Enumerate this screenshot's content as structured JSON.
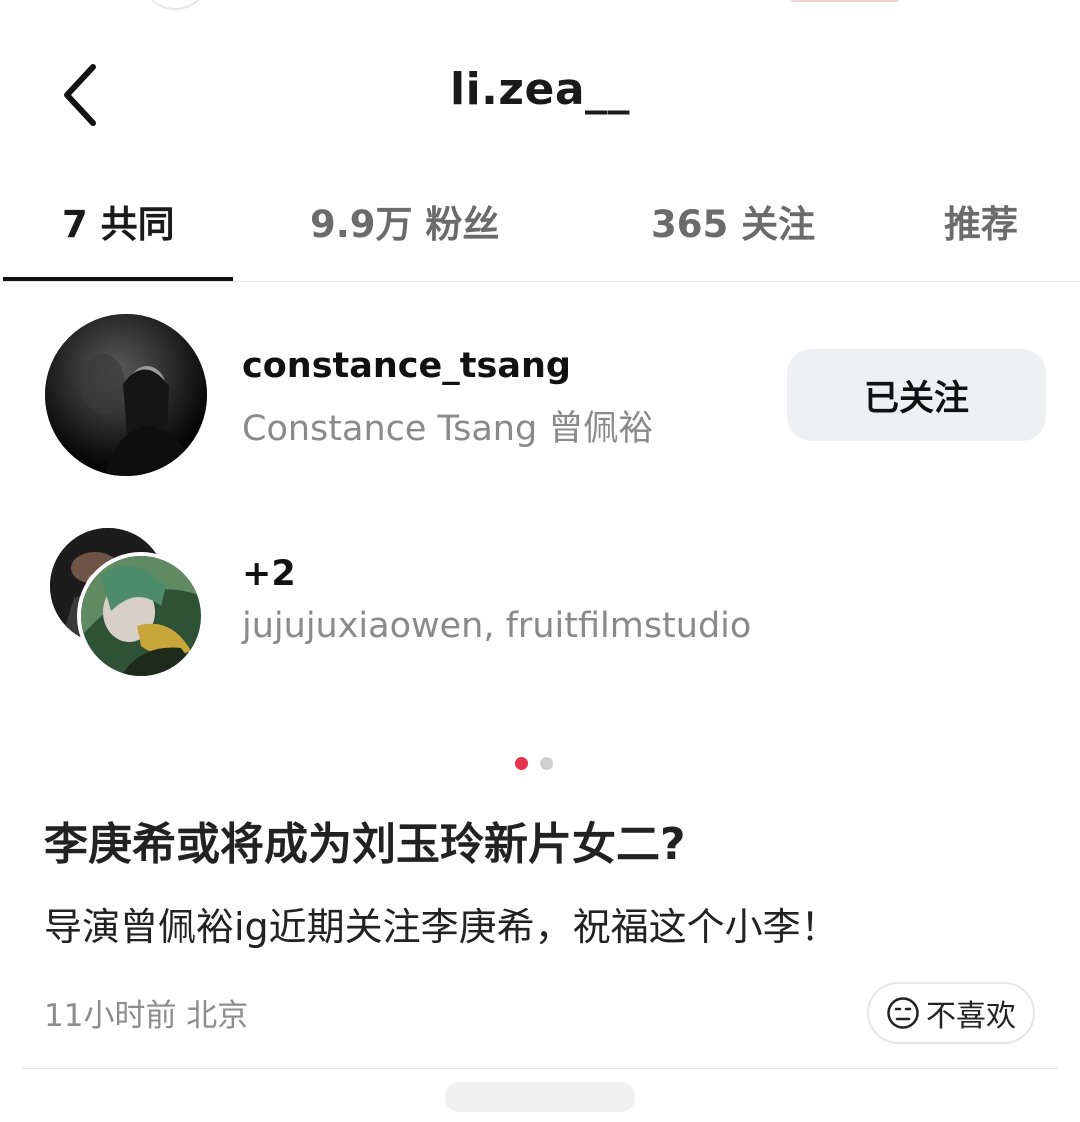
{
  "header": {
    "title": "li.zea__"
  },
  "tabs": [
    {
      "label": "7 共同",
      "active": true
    },
    {
      "label": "9.9万 粉丝",
      "active": false
    },
    {
      "label": "365 关注",
      "active": false
    },
    {
      "label": "推荐",
      "active": false
    }
  ],
  "mutuals": {
    "first": {
      "handle": "constance_tsang",
      "name": "Constance Tsang 曾佩裕",
      "follow_label": "已关注"
    },
    "more": {
      "count_label": "+2",
      "names": "jujujuxiaowen, fruitfilmstudio"
    }
  },
  "pager": {
    "pages": 2,
    "active": 0
  },
  "post": {
    "title": "李庚希或将成为刘玉玲新片女二?",
    "body": "导演曾佩裕ig近期关注李庚希，祝福这个小李！",
    "meta": "11小时前 北京",
    "dislike_label": "不喜欢"
  },
  "colors": {
    "accent_dot": "#e8344f",
    "follow_button_bg": "#eef0f3",
    "secondary_text": "#8a8a8a"
  },
  "icons": {
    "back": "chevron-left-icon",
    "dislike": "meh-face-icon"
  }
}
